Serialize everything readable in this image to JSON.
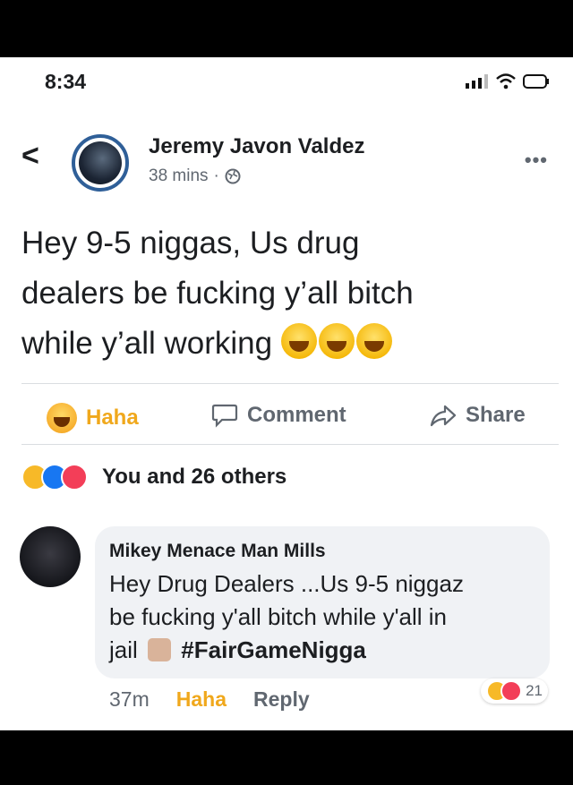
{
  "status": {
    "time": "8:34"
  },
  "post": {
    "author": "Jeremy Javon Valdez",
    "time": "38 mins",
    "dot": "·",
    "text_lines": [
      "Hey 9-5 niggas, Us drug",
      "dealers be fucking y’all bitch",
      "while y’all working"
    ],
    "emoji_count": 3
  },
  "actions": {
    "haha": "Haha",
    "comment": "Comment",
    "share": "Share"
  },
  "reactions": {
    "summary": "You and 26 others"
  },
  "comment": {
    "author": "Mikey Menace Man Mills",
    "text_lines": [
      "Hey Drug Dealers ...Us 9-5 niggaz",
      "be fucking y'all bitch while y'all in",
      "jail"
    ],
    "hashtag": "#FairGameNigga",
    "time": "37m",
    "haha": "Haha",
    "reply": "Reply",
    "reaction_count": "21"
  },
  "colors": {
    "accent_blue": "#1877f2",
    "haha_orange": "#f0a81c",
    "love_red": "#f33e58"
  },
  "icons": [
    "back-arrow-icon",
    "globe-icon",
    "more-icon",
    "haha-icon",
    "comment-icon",
    "share-icon",
    "signal-icon",
    "wifi-icon",
    "battery-icon"
  ]
}
